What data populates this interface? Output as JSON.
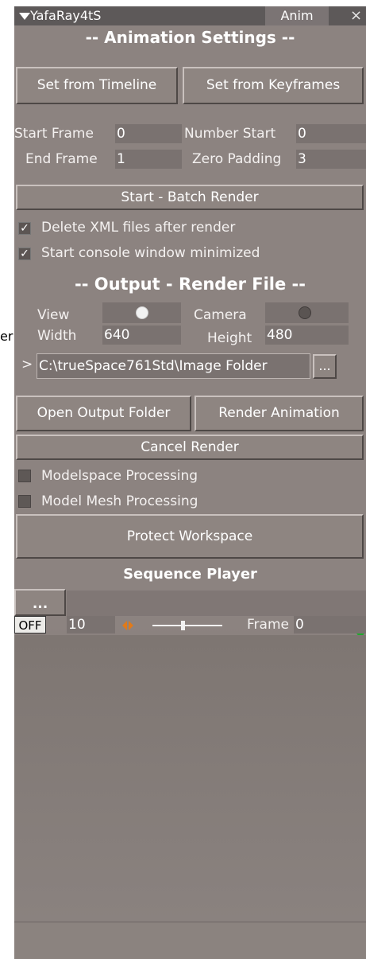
{
  "window": {
    "title": "YafaRay4tS",
    "tab": "Anim",
    "close_glyph": "×"
  },
  "outer_label": "er",
  "animation": {
    "heading": "-- Animation Settings --",
    "set_from_timeline": "Set from Timeline",
    "set_from_keyframes": "Set from Keyframes",
    "start_frame_label": "Start  Frame",
    "start_frame_value": "0",
    "number_start_label": "Number  Start",
    "number_start_value": "0",
    "end_frame_label": "End  Frame",
    "end_frame_value": "1",
    "zero_padding_label": "Zero Padding",
    "zero_padding_value": "3",
    "batch_render": "Start -  Batch Render",
    "delete_xml": "Delete XML files after render",
    "delete_xml_checked": true,
    "start_console": "Start console window minimized",
    "start_console_checked": true
  },
  "output": {
    "heading": "-- Output - Render File --",
    "view_label": "View",
    "camera_label": "Camera",
    "width_label": "Width",
    "width_value": "640",
    "height_label": "Height",
    "height_value": "480",
    "path_prefix": ">",
    "path_value": "C:\\trueSpace761Std\\Image Folder",
    "browse_label": "...",
    "open_output_folder": "Open Output Folder",
    "render_animation": "Render Animation",
    "cancel_render": "Cancel  Render",
    "modelspace_processing": "Modelspace Processing",
    "modelspace_checked": false,
    "model_mesh_processing": "Model Mesh Processing",
    "model_mesh_checked": false,
    "protect_workspace": "Protect Workspace"
  },
  "sequence_player": {
    "heading": "Sequence Player",
    "browse_label": "...",
    "off_label": "OFF",
    "fps_value": "10",
    "frame_label": "Frame",
    "frame_value": "0"
  },
  "colors": {
    "panel": "#8c8380",
    "titlebar": "#5d5959",
    "accent_orange": "#e07a1a",
    "accent_green": "#1faa2b"
  }
}
